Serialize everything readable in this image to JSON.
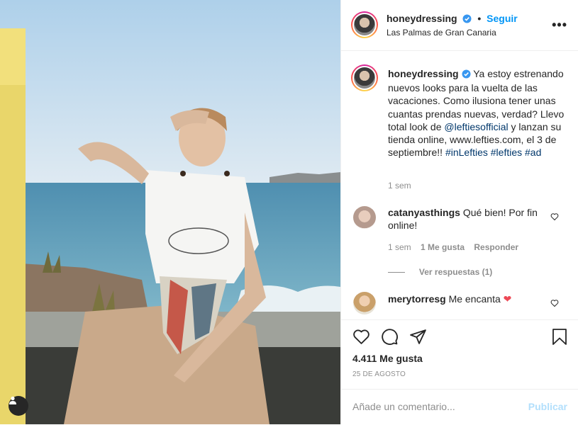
{
  "post": {
    "username": "honeydressing",
    "follow_label": "Seguir",
    "separator": "•",
    "location": "Las Palmas de Gran Canaria",
    "more_label": "•••"
  },
  "caption": {
    "username": "honeydressing",
    "text_1": "Ya estoy estrenando nuevos looks para la vuelta de las vacaciones. Como ilusiona tener unas cuantas prendas nuevas, verdad? Llevo total look de ",
    "mention": "@leftiesofficial",
    "text_2": " y lanzan su tienda online, www.lefties.com, el 3 de septiembre!!",
    "hashtags": [
      "#inLefties",
      "#lefties",
      "#ad"
    ],
    "time": "1 sem"
  },
  "comments": [
    {
      "username": "catanyasthings",
      "text": "Qué bien! Por fin online!",
      "time": "1 sem",
      "likes": "1 Me gusta",
      "reply_label": "Responder",
      "view_replies": "Ver respuestas (1)"
    },
    {
      "username": "merytorresg",
      "text": "Me encanta",
      "emoji": "❤"
    }
  ],
  "actions": {
    "likes": "4.411 Me gusta",
    "date": "25 DE AGOSTO",
    "comment_placeholder": "Añade un comentario...",
    "publish_label": "Publicar"
  },
  "colors": {
    "link_blue": "#0095f6",
    "mention": "#00376b",
    "muted": "#8e8e8e",
    "publish_disabled": "#b2dffc",
    "heart_red": "#ed4956"
  }
}
